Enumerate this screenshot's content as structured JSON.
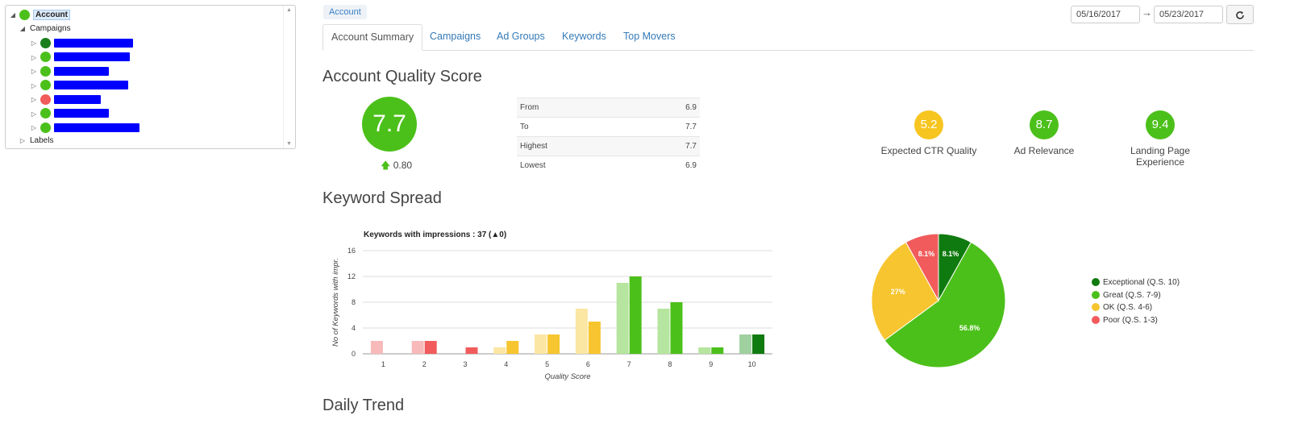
{
  "tree": {
    "root_label": "Account",
    "campaigns_label": "Campaigns",
    "labels_label": "Labels",
    "campaigns": [
      {
        "status_color": "#1a7f1a"
      },
      {
        "status_color": "#4cc01a"
      },
      {
        "status_color": "#4cc01a"
      },
      {
        "status_color": "#4cc01a"
      },
      {
        "status_color": "#f15b5b"
      },
      {
        "status_color": "#4cc01a"
      },
      {
        "status_color": "#4cc01a"
      }
    ]
  },
  "breadcrumb": "Account",
  "tabs": [
    "Account Summary",
    "Campaigns",
    "Ad Groups",
    "Keywords",
    "Top Movers"
  ],
  "date_range": {
    "from": "05/16/2017",
    "to": "05/23/2017",
    "arrow": "→",
    "refresh_icon": "refresh-icon"
  },
  "quality": {
    "title": "Account Quality Score",
    "score": "7.7",
    "delta": "0.80",
    "table": [
      {
        "label": "From",
        "value": "6.9"
      },
      {
        "label": "To",
        "value": "7.7"
      },
      {
        "label": "Highest",
        "value": "7.7"
      },
      {
        "label": "Lowest",
        "value": "6.9"
      }
    ],
    "metrics": [
      {
        "value": "5.2",
        "label": "Expected CTR Quality",
        "color": "#f7c520"
      },
      {
        "value": "8.7",
        "label": "Ad Relevance",
        "color": "#4cc01a"
      },
      {
        "value": "9.4",
        "label": "Landing Page Experience",
        "color": "#4cc01a"
      }
    ]
  },
  "spread_title": "Keyword Spread",
  "trend_title": "Daily Trend",
  "chart_data": [
    {
      "type": "bar",
      "title": "Keywords with impressions : 37 (▲0)",
      "xlabel": "Quality Score",
      "ylabel": "No of Keywords with impr.",
      "ylim": [
        0,
        16
      ],
      "yticks": [
        0,
        4,
        8,
        12,
        16
      ],
      "categories": [
        "1",
        "2",
        "3",
        "4",
        "5",
        "6",
        "7",
        "8",
        "9",
        "10"
      ],
      "series": [
        {
          "values": [
            2,
            2,
            0,
            1,
            3,
            7,
            11,
            7,
            1,
            3
          ]
        },
        {
          "values": [
            0,
            2,
            1,
            2,
            3,
            5,
            12,
            8,
            1,
            3
          ]
        }
      ],
      "grid": true
    },
    {
      "type": "pie",
      "slices": [
        {
          "label": "Exceptional (Q.S. 10)",
          "value": 8.1,
          "display": "8.1%",
          "color": "#0f7a0f"
        },
        {
          "label": "Great (Q.S. 7-9)",
          "value": 56.8,
          "display": "56.8%",
          "color": "#4cc01a"
        },
        {
          "label": "OK (Q.S. 4-6)",
          "value": 27,
          "display": "27%",
          "color": "#f7c52f"
        },
        {
          "label": "Poor (Q.S. 1-3)",
          "value": 8.1,
          "display": "8.1%",
          "color": "#f15b5b"
        }
      ],
      "legend": "right"
    }
  ]
}
